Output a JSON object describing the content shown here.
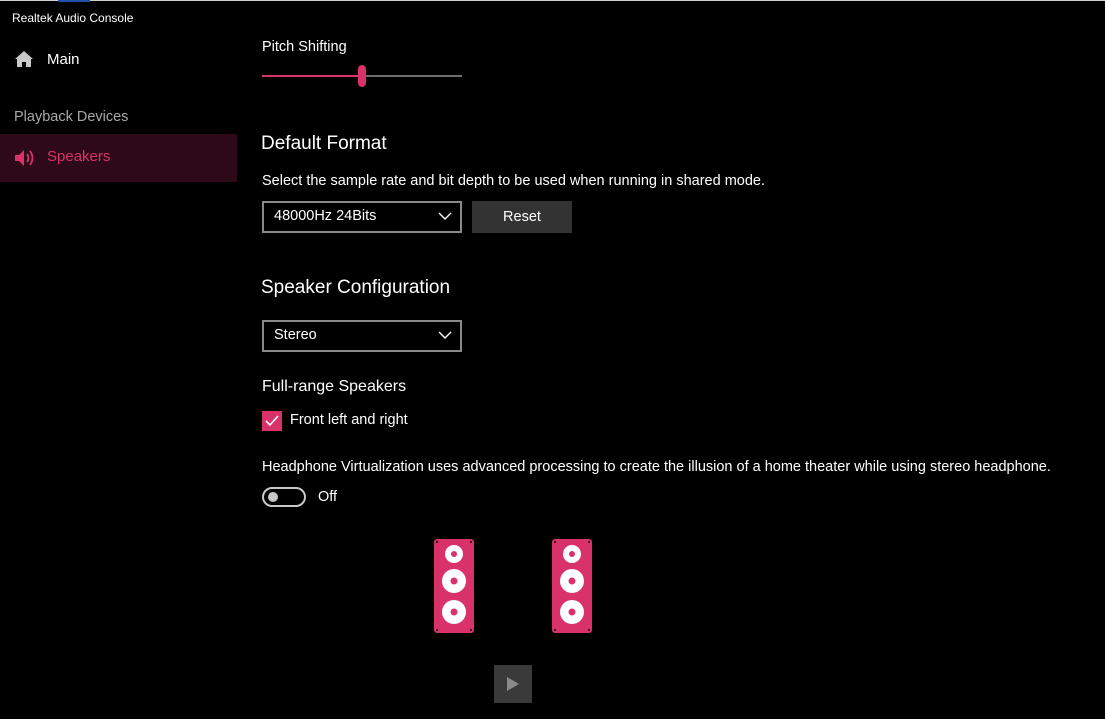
{
  "app": {
    "title": "Realtek Audio Console"
  },
  "sidebar": {
    "main_label": "Main",
    "section_label": "Playback Devices",
    "speakers_label": "Speakers",
    "icons": {
      "main": "home-icon",
      "speakers": "speaker-icon"
    }
  },
  "pitch": {
    "label": "Pitch Shifting",
    "value_fraction": 0.5
  },
  "format": {
    "heading": "Default Format",
    "description": "Select the sample rate and bit depth to be used when running in shared mode.",
    "selected": "48000Hz 24Bits",
    "reset_label": "Reset"
  },
  "speaker_config": {
    "heading": "Speaker Configuration",
    "selected": "Stereo"
  },
  "full_range": {
    "heading": "Full-range Speakers",
    "option_label": "Front left and right",
    "checked": true
  },
  "headphone": {
    "description": "Headphone Virtualization uses advanced processing to create the illusion of a home theater while using stereo headphone.",
    "toggle_label": "Off",
    "enabled": false
  },
  "colors": {
    "accent": "#d9326a",
    "background": "#000000",
    "selected_nav_bg": "#2e0a18"
  }
}
